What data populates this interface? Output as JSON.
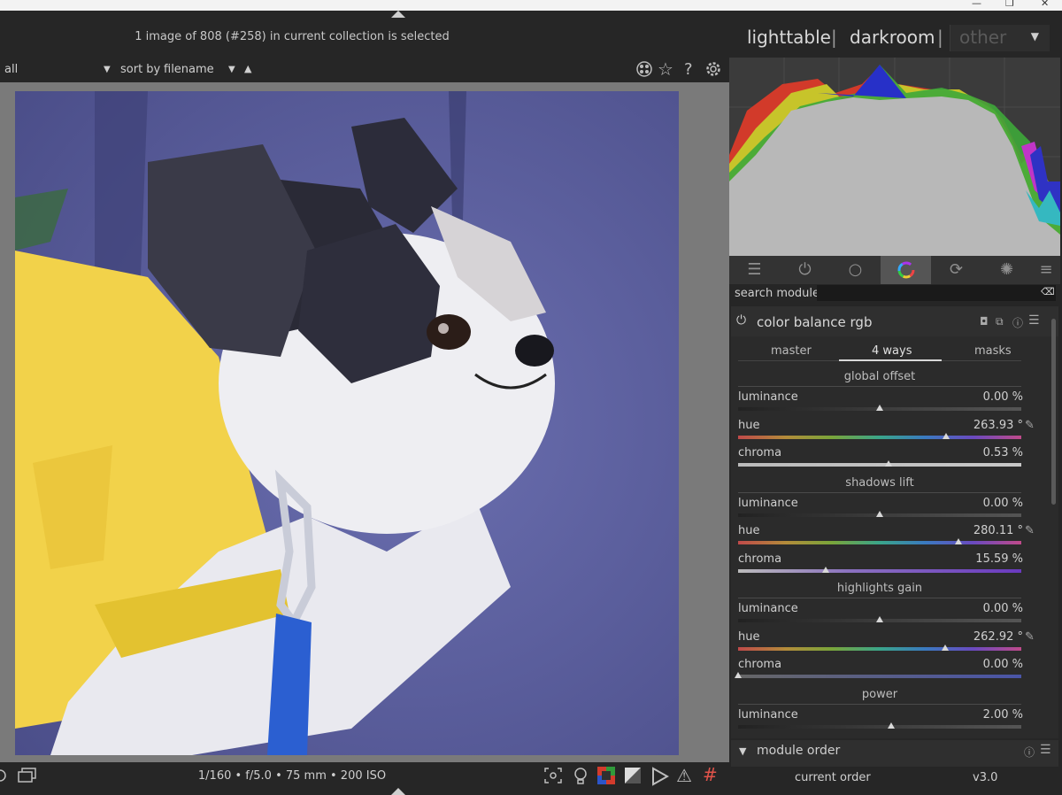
{
  "header": {
    "collection_info": "1 image of 808 (#258) in current collection is selected",
    "views": [
      "lighttable",
      "darkroom",
      "other"
    ],
    "separator": "|"
  },
  "filterbar": {
    "filter_value": "all",
    "sort_label": "sort by",
    "sort_value": "filename",
    "sort_direction": "▲"
  },
  "icons": {
    "top": [
      "color-labels-icon",
      "star-icon",
      "help-icon",
      "gear-icon"
    ],
    "bottom_left": [
      "dual-screen-icon",
      "display-icon"
    ],
    "bottom_right": [
      "focus-peaking-icon",
      "bulb-icon",
      "color-assessment-icon",
      "softproof-icon",
      "gamut-icon",
      "warning-icon",
      "guides-icon"
    ]
  },
  "bottombar": {
    "exif": "1/160 • f/5.0 • 75 mm • 200 ISO"
  },
  "module_panel": {
    "search_label": "search module",
    "search_value": "",
    "group_tabs": [
      "quick-access-icon",
      "power-icon",
      "circle-icon",
      "color-wheel-icon",
      "effects-icon",
      "aperture-icon",
      "menu-icon"
    ],
    "active_group": 3
  },
  "module": {
    "title": "color balance rgb",
    "tabs": [
      "master",
      "4 ways",
      "masks"
    ],
    "active_tab": "4 ways",
    "sections": [
      {
        "title": "global offset",
        "sliders": [
          {
            "label": "luminance",
            "value": "0.00 %",
            "pos": 0.5,
            "kind": "lum"
          },
          {
            "label": "hue",
            "value": "263.93 °",
            "pos": 0.733,
            "kind": "hue",
            "picker": true
          },
          {
            "label": "chroma",
            "value": "0.53 %",
            "pos": 0.53,
            "kind": "chroma0"
          }
        ]
      },
      {
        "title": "shadows lift",
        "sliders": [
          {
            "label": "luminance",
            "value": "0.00 %",
            "pos": 0.5,
            "kind": "lum"
          },
          {
            "label": "hue",
            "value": "280.11 °",
            "pos": 0.778,
            "kind": "hue",
            "picker": true
          },
          {
            "label": "chroma",
            "value": "15.59 %",
            "pos": 0.31,
            "kind": "chroma1"
          }
        ]
      },
      {
        "title": "highlights gain",
        "sliders": [
          {
            "label": "luminance",
            "value": "0.00 %",
            "pos": 0.5,
            "kind": "lum"
          },
          {
            "label": "hue",
            "value": "262.92 °",
            "pos": 0.73,
            "kind": "hue",
            "picker": true
          },
          {
            "label": "chroma",
            "value": "0.00 %",
            "pos": 0.0,
            "kind": "chroma2"
          }
        ]
      },
      {
        "title": "power",
        "sliders": [
          {
            "label": "luminance",
            "value": "2.00 %",
            "pos": 0.54,
            "kind": "lum"
          }
        ]
      }
    ]
  },
  "module_order": {
    "title": "module order",
    "current_label": "current order",
    "version": "v3.0"
  },
  "colors": {
    "panel_bg": "#262626",
    "center_bg": "#7a7a7a",
    "histogram_bg": "#3b3b3b"
  }
}
